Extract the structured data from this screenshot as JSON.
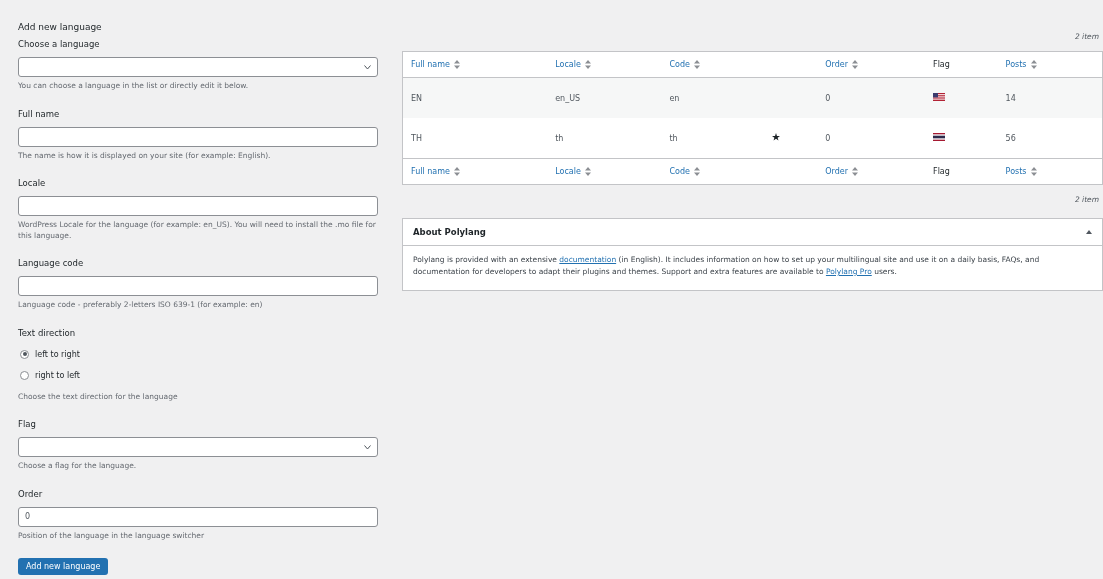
{
  "form": {
    "title": "Add new language",
    "fields": [
      {
        "kind": "select",
        "label": "Choose a language",
        "hint": "You can choose a language in the list or directly edit it below."
      },
      {
        "kind": "text",
        "label": "Full name",
        "hint": "The name is how it is displayed on your site (for example: English)."
      },
      {
        "kind": "text",
        "label": "Locale",
        "hint": "WordPress Locale for the language (for example: en_US). You will need to install the .mo file for this language."
      },
      {
        "kind": "text",
        "label": "Language code",
        "hint": "Language code - preferably 2-letters ISO 639-1 (for example: en)"
      },
      {
        "kind": "radio",
        "label": "Text direction",
        "options": [
          {
            "label": "left to right",
            "selected": true
          },
          {
            "label": "right to left",
            "selected": false
          }
        ],
        "hint": "Choose the text direction for the language"
      },
      {
        "kind": "select",
        "label": "Flag",
        "hint": "Choose a flag for the language."
      },
      {
        "kind": "text",
        "label": "Order",
        "value": "0",
        "hint": "Position of the language in the language switcher"
      }
    ],
    "submit": "Add new language"
  },
  "table": {
    "count_top": "2 item",
    "count_bottom": "2 item",
    "header_columns": [
      {
        "label": "Full name",
        "sortable": true
      },
      {
        "label": "Locale",
        "sortable": true
      },
      {
        "label": "Code",
        "sortable": true
      },
      {
        "sortable": false
      },
      {
        "label": "Order",
        "sortable": true
      },
      {
        "label": "Flag",
        "sortable": false
      },
      {
        "label": "Posts",
        "sortable": true
      }
    ],
    "footer_columns": [
      {
        "label": "Full name",
        "sortable": true
      },
      {
        "label": "Locale",
        "sortable": true
      },
      {
        "label": "Code",
        "sortable": true
      },
      {
        "sortable": false
      },
      {
        "label": "Order",
        "sortable": true
      },
      {
        "label": "Flag",
        "sortable": false
      },
      {
        "label": "Posts",
        "sortable": true
      }
    ],
    "rows": [
      {
        "name": "EN",
        "locale": "en_US",
        "code": "en",
        "default": false,
        "order": "0",
        "flag": {
          "kind": "us"
        },
        "posts": "14"
      },
      {
        "name": "TH",
        "locale": "th",
        "code": "th",
        "default": true,
        "order": "0",
        "flag": {
          "kind": "th"
        },
        "posts": "56"
      }
    ]
  },
  "about": {
    "title": "About Polylang",
    "expanded": true,
    "text": [
      {
        "kind": "text",
        "value": "Polylang is provided with an extensive "
      },
      {
        "kind": "link",
        "value": "documentation"
      },
      {
        "kind": "text",
        "value": " (in English). It includes information on how to set up your multilingual site and use it on a daily basis, FAQs, and documentation for developers to adapt their plugins and themes. Support and extra features are available to "
      },
      {
        "kind": "link",
        "value": "Polylang Pro"
      },
      {
        "kind": "text",
        "value": " users."
      }
    ]
  }
}
